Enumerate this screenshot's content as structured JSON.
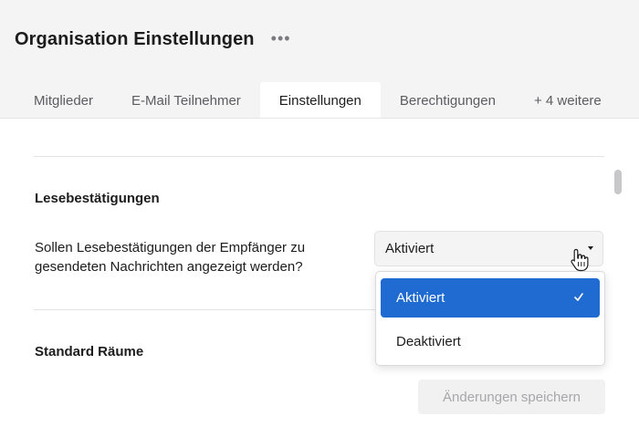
{
  "header": {
    "title": "Organisation Einstellungen",
    "more_icon": "ellipsis-icon",
    "more_label": "•••"
  },
  "tabs": [
    {
      "label": "Mitglieder",
      "active": false
    },
    {
      "label": "E-Mail Teilnehmer",
      "active": false
    },
    {
      "label": "Einstellungen",
      "active": true
    },
    {
      "label": "Berechtigungen",
      "active": false
    },
    {
      "label": "+ 4 weitere",
      "active": false
    }
  ],
  "read_receipts": {
    "heading": "Lesebestätigungen",
    "question": "Sollen Lesebestätigungen der Empfänger zu gesendeten Nachrichten angezeigt werden?",
    "select_value": "Aktiviert",
    "options": [
      {
        "label": "Aktiviert",
        "selected": true
      },
      {
        "label": "Deaktiviert",
        "selected": false
      }
    ]
  },
  "default_rooms": {
    "heading": "Standard Räume"
  },
  "save_button": {
    "label": "Änderungen speichern",
    "disabled": true
  },
  "colors": {
    "accent": "#1f6bd1",
    "header_bg": "#f4f4f5"
  }
}
